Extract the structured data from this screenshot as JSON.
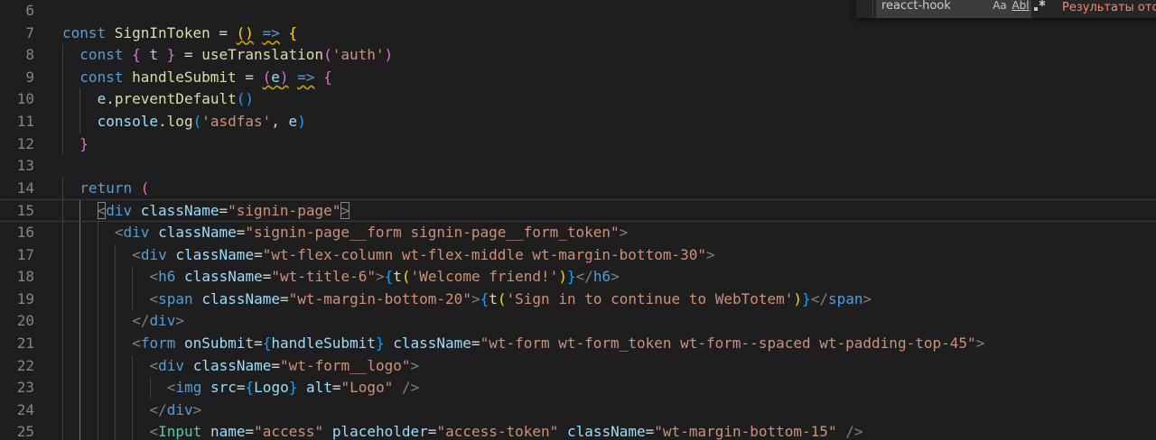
{
  "find_widget": {
    "query": "reacct-hook",
    "result_text": "Результаты отсу",
    "option_match_case": "Aa",
    "option_whole_word": "Abl"
  },
  "lines": [
    {
      "n": "6",
      "indent": 0,
      "current": false,
      "tokens": []
    },
    {
      "n": "7",
      "indent": 0,
      "current": false,
      "tokens": [
        {
          "t": "const ",
          "c": "kw"
        },
        {
          "t": "SignInToken",
          "c": "fn"
        },
        {
          "t": " = ",
          "c": "punc"
        },
        {
          "t": "()",
          "c": "b1",
          "sq": true
        },
        {
          "t": " ",
          "c": "punc"
        },
        {
          "t": "=>",
          "c": "kw",
          "sq": true
        },
        {
          "t": " ",
          "c": "punc"
        },
        {
          "t": "{",
          "c": "b1"
        }
      ]
    },
    {
      "n": "8",
      "indent": 2,
      "current": false,
      "tokens": [
        {
          "t": "const ",
          "c": "kw"
        },
        {
          "t": "{",
          "c": "b2"
        },
        {
          "t": " ",
          "c": "punc"
        },
        {
          "t": "t",
          "c": "var"
        },
        {
          "t": " ",
          "c": "punc"
        },
        {
          "t": "}",
          "c": "b2"
        },
        {
          "t": " = ",
          "c": "punc"
        },
        {
          "t": "useTranslation",
          "c": "fn"
        },
        {
          "t": "(",
          "c": "b2"
        },
        {
          "t": "'auth'",
          "c": "str"
        },
        {
          "t": ")",
          "c": "b2"
        }
      ]
    },
    {
      "n": "9",
      "indent": 2,
      "current": false,
      "tokens": [
        {
          "t": "const ",
          "c": "kw"
        },
        {
          "t": "handleSubmit",
          "c": "fn"
        },
        {
          "t": " = ",
          "c": "punc"
        },
        {
          "t": "(",
          "c": "b2",
          "sq": true
        },
        {
          "t": "e",
          "c": "var",
          "sq": true
        },
        {
          "t": ")",
          "c": "b2",
          "sq": true
        },
        {
          "t": " ",
          "c": "punc"
        },
        {
          "t": "=>",
          "c": "kw",
          "sq": true
        },
        {
          "t": " ",
          "c": "punc"
        },
        {
          "t": "{",
          "c": "b2"
        }
      ]
    },
    {
      "n": "10",
      "indent": 4,
      "current": false,
      "tokens": [
        {
          "t": "e",
          "c": "var"
        },
        {
          "t": ".",
          "c": "punc"
        },
        {
          "t": "preventDefault",
          "c": "fn"
        },
        {
          "t": "()",
          "c": "b3"
        }
      ]
    },
    {
      "n": "11",
      "indent": 4,
      "current": false,
      "tokens": [
        {
          "t": "console",
          "c": "var"
        },
        {
          "t": ".",
          "c": "punc"
        },
        {
          "t": "log",
          "c": "fn"
        },
        {
          "t": "(",
          "c": "b3"
        },
        {
          "t": "'asdfas'",
          "c": "str"
        },
        {
          "t": ", ",
          "c": "punc"
        },
        {
          "t": "e",
          "c": "var"
        },
        {
          "t": ")",
          "c": "b3"
        }
      ]
    },
    {
      "n": "12",
      "indent": 2,
      "current": false,
      "tokens": [
        {
          "t": "}",
          "c": "b2"
        }
      ]
    },
    {
      "n": "13",
      "indent": 0,
      "current": false,
      "tokens": []
    },
    {
      "n": "14",
      "indent": 2,
      "current": false,
      "tokens": [
        {
          "t": "return ",
          "c": "kw"
        },
        {
          "t": "(",
          "c": "b2"
        }
      ]
    },
    {
      "n": "15",
      "indent": 4,
      "current": true,
      "tokens": [
        {
          "t": "<",
          "c": "ang",
          "box": true
        },
        {
          "t": "div",
          "c": "tag"
        },
        {
          "t": " ",
          "c": "punc"
        },
        {
          "t": "className",
          "c": "attr"
        },
        {
          "t": "=",
          "c": "punc"
        },
        {
          "t": "\"signin-page\"",
          "c": "str"
        },
        {
          "t": ">",
          "c": "ang",
          "box": true
        }
      ]
    },
    {
      "n": "16",
      "indent": 6,
      "current": false,
      "tokens": [
        {
          "t": "<",
          "c": "ang"
        },
        {
          "t": "div",
          "c": "tag"
        },
        {
          "t": " ",
          "c": "punc"
        },
        {
          "t": "className",
          "c": "attr"
        },
        {
          "t": "=",
          "c": "punc"
        },
        {
          "t": "\"signin-page__form signin-page__form_token\"",
          "c": "str"
        },
        {
          "t": ">",
          "c": "ang"
        }
      ]
    },
    {
      "n": "17",
      "indent": 8,
      "current": false,
      "tokens": [
        {
          "t": "<",
          "c": "ang"
        },
        {
          "t": "div",
          "c": "tag"
        },
        {
          "t": " ",
          "c": "punc"
        },
        {
          "t": "className",
          "c": "attr"
        },
        {
          "t": "=",
          "c": "punc"
        },
        {
          "t": "\"wt-flex-column wt-flex-middle wt-margin-bottom-30\"",
          "c": "str"
        },
        {
          "t": ">",
          "c": "ang"
        }
      ]
    },
    {
      "n": "18",
      "indent": 10,
      "current": false,
      "tokens": [
        {
          "t": "<",
          "c": "ang"
        },
        {
          "t": "h6",
          "c": "tag"
        },
        {
          "t": " ",
          "c": "punc"
        },
        {
          "t": "className",
          "c": "attr"
        },
        {
          "t": "=",
          "c": "punc"
        },
        {
          "t": "\"wt-title-6\"",
          "c": "str"
        },
        {
          "t": ">",
          "c": "ang"
        },
        {
          "t": "{",
          "c": "b3"
        },
        {
          "t": "t",
          "c": "fn"
        },
        {
          "t": "(",
          "c": "b1"
        },
        {
          "t": "'Welcome friend!'",
          "c": "str"
        },
        {
          "t": ")",
          "c": "b1"
        },
        {
          "t": "}",
          "c": "b3"
        },
        {
          "t": "</",
          "c": "ang"
        },
        {
          "t": "h6",
          "c": "tag"
        },
        {
          "t": ">",
          "c": "ang"
        }
      ]
    },
    {
      "n": "19",
      "indent": 10,
      "current": false,
      "tokens": [
        {
          "t": "<",
          "c": "ang"
        },
        {
          "t": "span",
          "c": "tag"
        },
        {
          "t": " ",
          "c": "punc"
        },
        {
          "t": "className",
          "c": "attr"
        },
        {
          "t": "=",
          "c": "punc"
        },
        {
          "t": "\"wt-margin-bottom-20\"",
          "c": "str"
        },
        {
          "t": ">",
          "c": "ang"
        },
        {
          "t": "{",
          "c": "b3"
        },
        {
          "t": "t",
          "c": "fn"
        },
        {
          "t": "(",
          "c": "b1"
        },
        {
          "t": "'Sign in to continue to WebTotem'",
          "c": "str"
        },
        {
          "t": ")",
          "c": "b1"
        },
        {
          "t": "}",
          "c": "b3"
        },
        {
          "t": "</",
          "c": "ang"
        },
        {
          "t": "span",
          "c": "tag"
        },
        {
          "t": ">",
          "c": "ang"
        }
      ]
    },
    {
      "n": "20",
      "indent": 8,
      "current": false,
      "tokens": [
        {
          "t": "</",
          "c": "ang"
        },
        {
          "t": "div",
          "c": "tag"
        },
        {
          "t": ">",
          "c": "ang"
        }
      ]
    },
    {
      "n": "21",
      "indent": 8,
      "current": false,
      "tokens": [
        {
          "t": "<",
          "c": "ang"
        },
        {
          "t": "form",
          "c": "tag"
        },
        {
          "t": " ",
          "c": "punc"
        },
        {
          "t": "onSubmit",
          "c": "attr"
        },
        {
          "t": "=",
          "c": "punc"
        },
        {
          "t": "{",
          "c": "b3"
        },
        {
          "t": "handleSubmit",
          "c": "var"
        },
        {
          "t": "}",
          "c": "b3"
        },
        {
          "t": " ",
          "c": "punc"
        },
        {
          "t": "className",
          "c": "attr"
        },
        {
          "t": "=",
          "c": "punc"
        },
        {
          "t": "\"wt-form wt-form_token wt-form--spaced wt-padding-top-45\"",
          "c": "str"
        },
        {
          "t": ">",
          "c": "ang"
        }
      ]
    },
    {
      "n": "22",
      "indent": 10,
      "current": false,
      "tokens": [
        {
          "t": "<",
          "c": "ang"
        },
        {
          "t": "div",
          "c": "tag"
        },
        {
          "t": " ",
          "c": "punc"
        },
        {
          "t": "className",
          "c": "attr"
        },
        {
          "t": "=",
          "c": "punc"
        },
        {
          "t": "\"wt-form__logo\"",
          "c": "str"
        },
        {
          "t": ">",
          "c": "ang"
        }
      ]
    },
    {
      "n": "23",
      "indent": 12,
      "current": false,
      "tokens": [
        {
          "t": "<",
          "c": "ang"
        },
        {
          "t": "img",
          "c": "tag"
        },
        {
          "t": " ",
          "c": "punc"
        },
        {
          "t": "src",
          "c": "attr"
        },
        {
          "t": "=",
          "c": "punc"
        },
        {
          "t": "{",
          "c": "b3"
        },
        {
          "t": "Logo",
          "c": "var"
        },
        {
          "t": "}",
          "c": "b3"
        },
        {
          "t": " ",
          "c": "punc"
        },
        {
          "t": "alt",
          "c": "attr"
        },
        {
          "t": "=",
          "c": "punc"
        },
        {
          "t": "\"Logo\"",
          "c": "str"
        },
        {
          "t": " ",
          "c": "punc"
        },
        {
          "t": "/>",
          "c": "ang"
        }
      ]
    },
    {
      "n": "24",
      "indent": 10,
      "current": false,
      "tokens": [
        {
          "t": "</",
          "c": "ang"
        },
        {
          "t": "div",
          "c": "tag"
        },
        {
          "t": ">",
          "c": "ang"
        }
      ]
    },
    {
      "n": "25",
      "indent": 10,
      "current": false,
      "tokens": [
        {
          "t": "<",
          "c": "ang"
        },
        {
          "t": "Input",
          "c": "comp"
        },
        {
          "t": " ",
          "c": "punc"
        },
        {
          "t": "name",
          "c": "attr"
        },
        {
          "t": "=",
          "c": "punc"
        },
        {
          "t": "\"access\"",
          "c": "str"
        },
        {
          "t": " ",
          "c": "punc"
        },
        {
          "t": "placeholder",
          "c": "attr"
        },
        {
          "t": "=",
          "c": "punc"
        },
        {
          "t": "\"access-token\"",
          "c": "str"
        },
        {
          "t": " ",
          "c": "punc"
        },
        {
          "t": "className",
          "c": "attr"
        },
        {
          "t": "=",
          "c": "punc"
        },
        {
          "t": "\"wt-margin-bottom-15\"",
          "c": "str"
        },
        {
          "t": " ",
          "c": "punc"
        },
        {
          "t": "/>",
          "c": "ang"
        }
      ]
    }
  ]
}
